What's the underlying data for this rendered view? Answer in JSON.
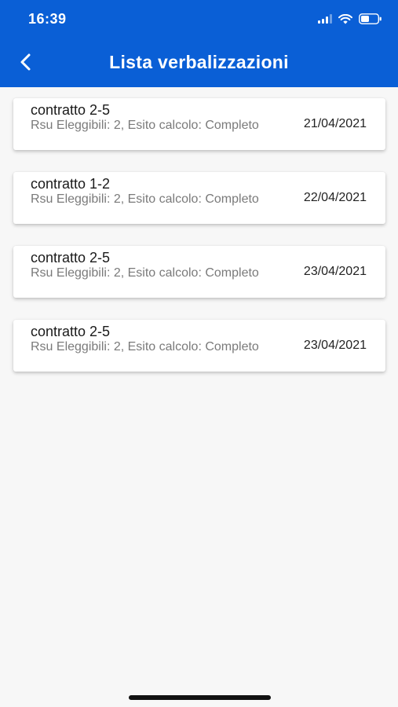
{
  "status_bar": {
    "time": "16:39",
    "icons": [
      "signal-icon",
      "wifi-icon",
      "battery-icon"
    ]
  },
  "header": {
    "title": "Lista verbalizzazioni",
    "back_icon": "chevron-left-icon",
    "background_color": "#0a5fd6"
  },
  "items": [
    {
      "title": "contratto 2-5",
      "subtitle": "Rsu Eleggibili: 2, Esito calcolo: Completo",
      "date": "21/04/2021"
    },
    {
      "title": "contratto 1-2",
      "subtitle": "Rsu Eleggibili: 2, Esito calcolo: Completo",
      "date": "22/04/2021"
    },
    {
      "title": "contratto 2-5",
      "subtitle": "Rsu Eleggibili: 2, Esito calcolo: Completo",
      "date": "23/04/2021"
    },
    {
      "title": "contratto 2-5",
      "subtitle": "Rsu Eleggibili: 2, Esito calcolo: Completo",
      "date": "23/04/2021"
    }
  ]
}
